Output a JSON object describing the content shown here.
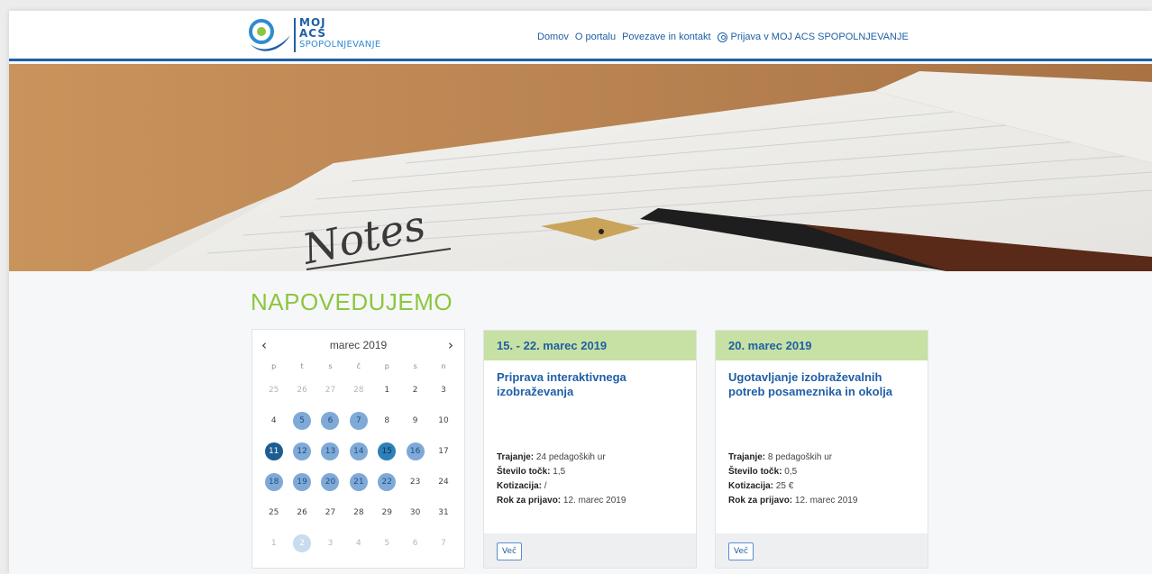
{
  "header": {
    "logo": {
      "line1": "MOJ",
      "line2": "ACS",
      "line3": "SPOPOLNJEVANJE"
    },
    "nav": [
      {
        "label": "Domov"
      },
      {
        "label": "O portalu"
      },
      {
        "label": "Povezave in kontakt"
      }
    ],
    "login_label": "Prijava v MOJ ACS SPOPOLNJEVANJE"
  },
  "hero": {
    "handwriting": "Notes"
  },
  "section": {
    "heading": "NAPOVEDUJEMO"
  },
  "calendar": {
    "month_label": "marec 2019",
    "prev": "‹",
    "next": "›",
    "weekdays": [
      "p",
      "t",
      "s",
      "č",
      "p",
      "s",
      "n"
    ],
    "weeks": [
      [
        {
          "d": "25",
          "t": "muted"
        },
        {
          "d": "26",
          "t": "muted"
        },
        {
          "d": "27",
          "t": "muted"
        },
        {
          "d": "28",
          "t": "muted"
        },
        {
          "d": "1",
          "t": ""
        },
        {
          "d": "2",
          "t": ""
        },
        {
          "d": "3",
          "t": ""
        }
      ],
      [
        {
          "d": "4",
          "t": ""
        },
        {
          "d": "5",
          "t": "ev"
        },
        {
          "d": "6",
          "t": "ev"
        },
        {
          "d": "7",
          "t": "ev"
        },
        {
          "d": "8",
          "t": ""
        },
        {
          "d": "9",
          "t": ""
        },
        {
          "d": "10",
          "t": ""
        }
      ],
      [
        {
          "d": "11",
          "t": "sel"
        },
        {
          "d": "12",
          "t": "ev"
        },
        {
          "d": "13",
          "t": "ev"
        },
        {
          "d": "14",
          "t": "ev"
        },
        {
          "d": "15",
          "t": "today"
        },
        {
          "d": "16",
          "t": "ev"
        },
        {
          "d": "17",
          "t": ""
        }
      ],
      [
        {
          "d": "18",
          "t": "ev"
        },
        {
          "d": "19",
          "t": "ev"
        },
        {
          "d": "20",
          "t": "ev"
        },
        {
          "d": "21",
          "t": "ev"
        },
        {
          "d": "22",
          "t": "ev"
        },
        {
          "d": "23",
          "t": ""
        },
        {
          "d": "24",
          "t": ""
        }
      ],
      [
        {
          "d": "25",
          "t": ""
        },
        {
          "d": "26",
          "t": ""
        },
        {
          "d": "27",
          "t": ""
        },
        {
          "d": "28",
          "t": ""
        },
        {
          "d": "29",
          "t": ""
        },
        {
          "d": "30",
          "t": ""
        },
        {
          "d": "31",
          "t": ""
        }
      ],
      [
        {
          "d": "1",
          "t": "muted"
        },
        {
          "d": "2",
          "t": "next"
        },
        {
          "d": "3",
          "t": "muted"
        },
        {
          "d": "4",
          "t": "muted"
        },
        {
          "d": "5",
          "t": "muted"
        },
        {
          "d": "6",
          "t": "muted"
        },
        {
          "d": "7",
          "t": "muted"
        }
      ]
    ]
  },
  "cards": [
    {
      "date": "15. - 22. marec 2019",
      "title": "Priprava interaktivnega izobraževanja",
      "meta": [
        {
          "label": "Trajanje:",
          "value": "24 pedagoških ur"
        },
        {
          "label": "Število točk:",
          "value": "1,5"
        },
        {
          "label": "Kotizacija:",
          "value": "/"
        },
        {
          "label": "Rok za prijavo:",
          "value": "12. marec 2019"
        }
      ],
      "button": "Več"
    },
    {
      "date": "20. marec 2019",
      "title": "Ugotavljanje izobraževalnih potreb posameznika in okolja",
      "meta": [
        {
          "label": "Trajanje:",
          "value": "8 pedagoških ur"
        },
        {
          "label": "Število točk:",
          "value": "0,5"
        },
        {
          "label": "Kotizacija:",
          "value": "25 €"
        },
        {
          "label": "Rok za prijavo:",
          "value": "12. marec 2019"
        }
      ],
      "button": "Več"
    }
  ],
  "colors": {
    "brand_blue": "#1f5fa6",
    "accent_green": "#8dc63f",
    "card_header_green": "#c6e1a3",
    "event_blue": "#7fa9d6"
  }
}
